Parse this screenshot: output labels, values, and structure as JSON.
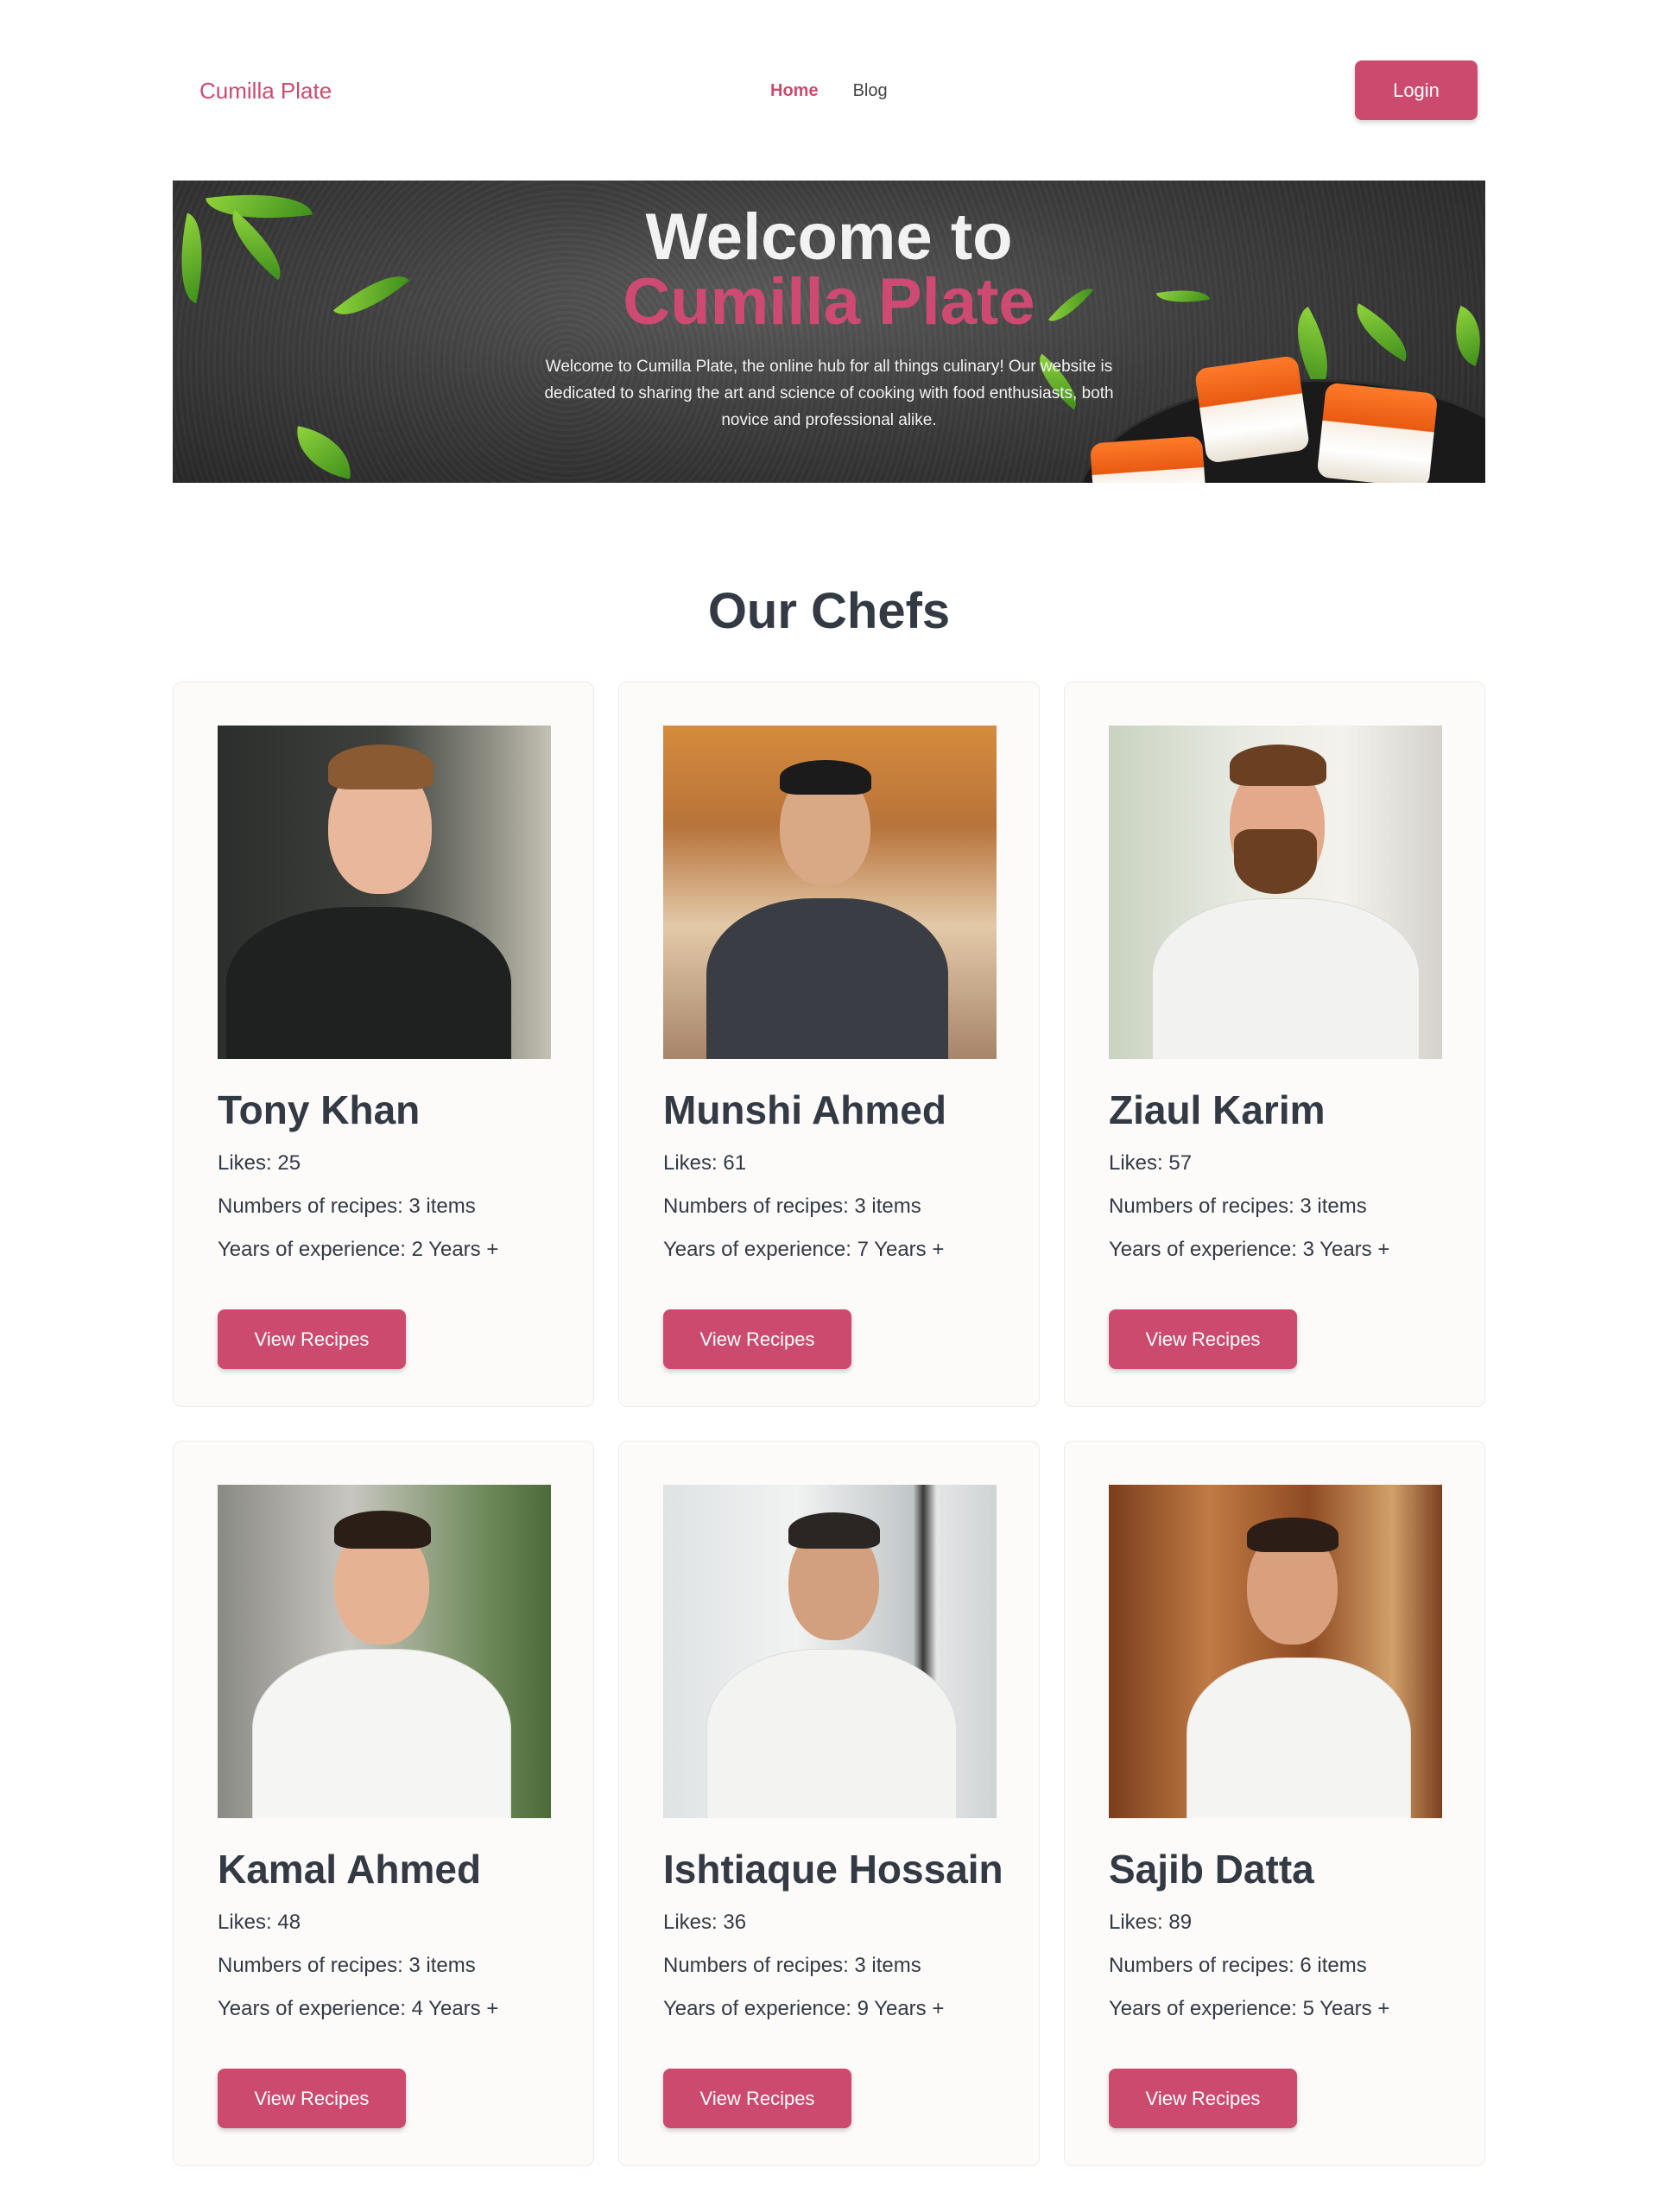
{
  "header": {
    "brand": "Cumilla Plate",
    "nav": [
      {
        "label": "Home",
        "active": true
      },
      {
        "label": "Blog",
        "active": false
      }
    ],
    "login_label": "Login"
  },
  "hero": {
    "title_line1": "Welcome to",
    "title_line2": "Cumilla Plate",
    "description": "Welcome to Cumilla Plate, the online hub for all things culinary! Our website is dedicated to sharing the art and science of cooking with food enthusiasts, both novice and professional alike."
  },
  "chefs_section": {
    "title": "Our Chefs",
    "button_label": "View Recipes",
    "chefs": [
      {
        "name": "Tony Khan",
        "likes": "Likes: 25",
        "recipes": "Numbers of recipes: 3 items",
        "experience": "Years of experience: 2 Years +"
      },
      {
        "name": "Munshi Ahmed",
        "likes": "Likes: 61",
        "recipes": "Numbers of recipes: 3 items",
        "experience": "Years of experience: 7 Years +"
      },
      {
        "name": "Ziaul Karim",
        "likes": "Likes: 57",
        "recipes": "Numbers of recipes: 3 items",
        "experience": "Years of experience: 3 Years +"
      },
      {
        "name": "Kamal Ahmed",
        "likes": "Likes: 48",
        "recipes": "Numbers of recipes: 3 items",
        "experience": "Years of experience: 4 Years +"
      },
      {
        "name": "Ishtiaque Hossain",
        "likes": "Likes: 36",
        "recipes": "Numbers of recipes: 3 items",
        "experience": "Years of experience: 9 Years +"
      },
      {
        "name": "Sajib Datta",
        "likes": "Likes: 89",
        "recipes": "Numbers of recipes: 6 items",
        "experience": "Years of experience: 5 Years +"
      }
    ]
  },
  "colors": {
    "accent": "#cc4a6e",
    "text": "#333a44",
    "card_background": "#fcfbfa"
  }
}
